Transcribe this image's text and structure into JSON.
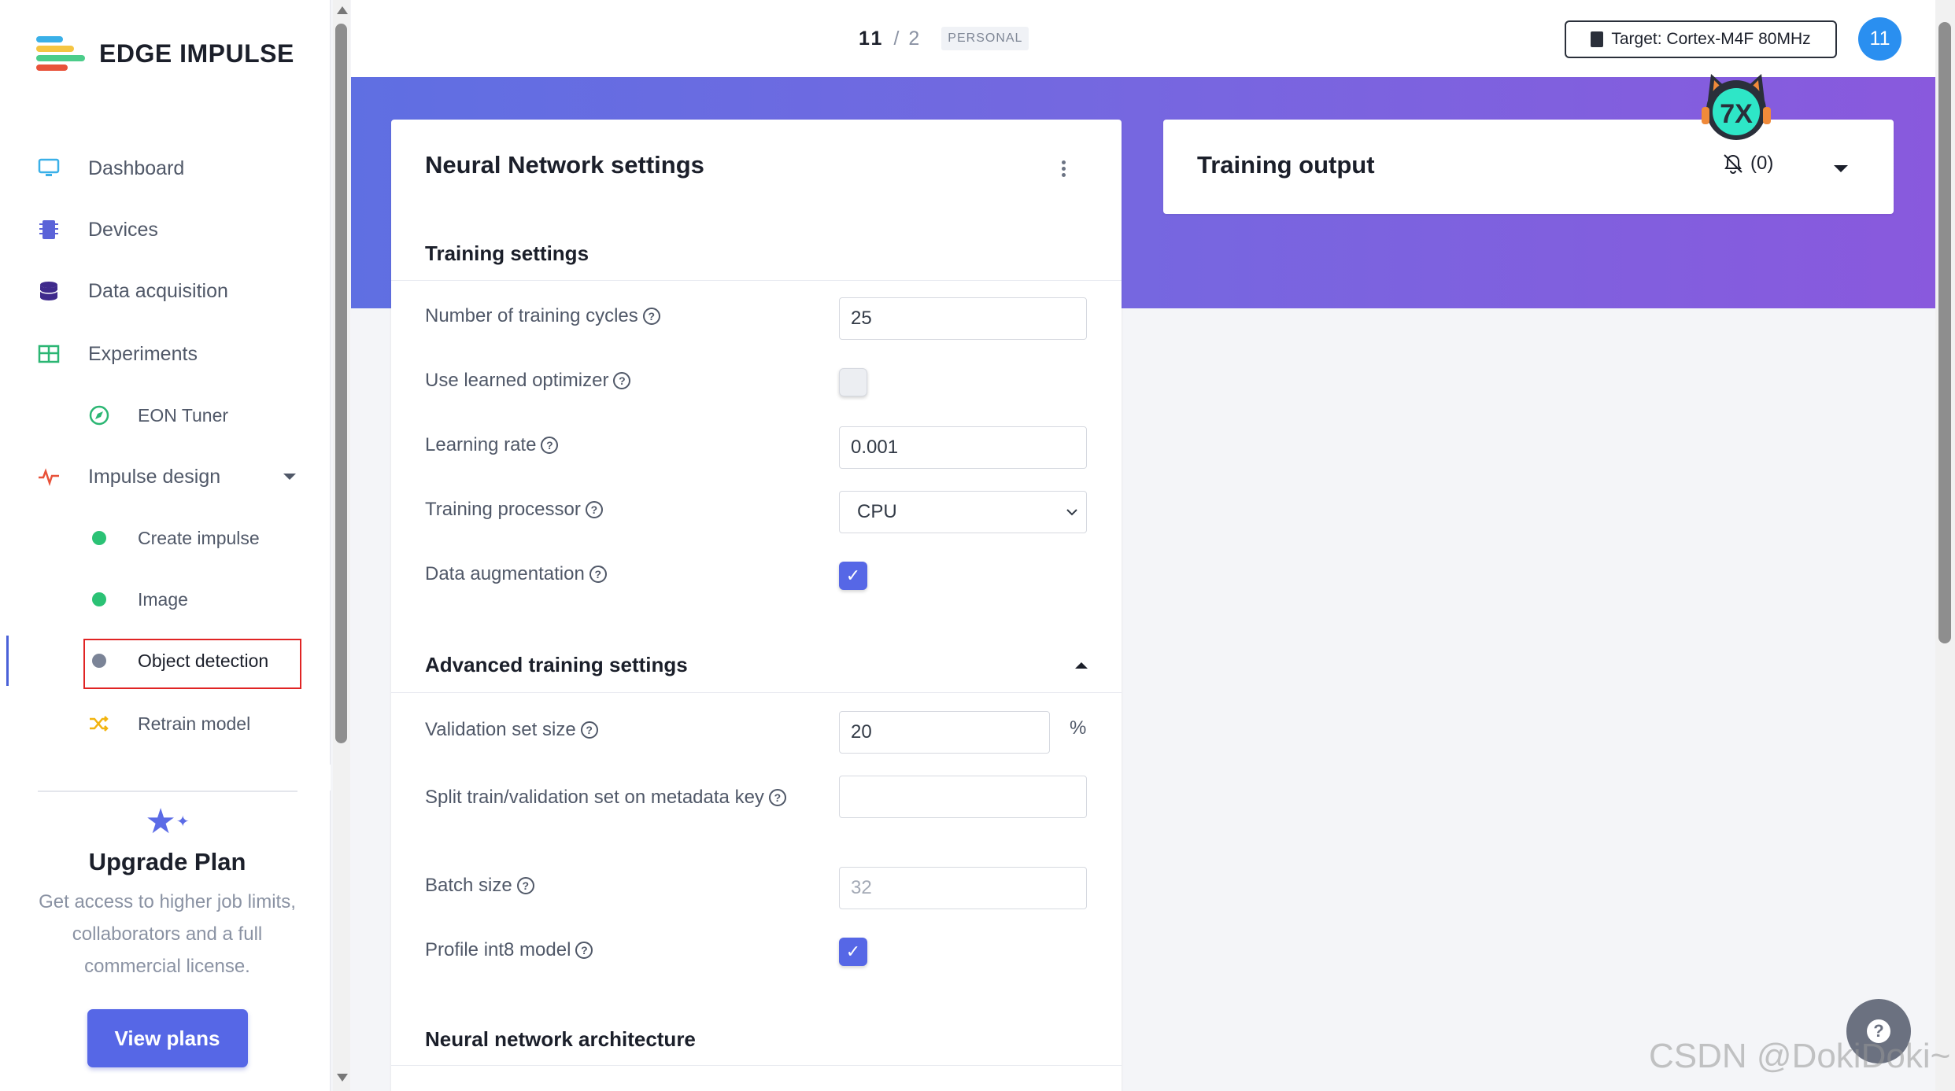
{
  "app": {
    "name": "EDGE IMPULSE"
  },
  "sidebar": {
    "items": [
      {
        "label": "Dashboard"
      },
      {
        "label": "Devices"
      },
      {
        "label": "Data acquisition"
      },
      {
        "label": "Experiments"
      },
      {
        "label": "EON Tuner"
      },
      {
        "label": "Impulse design"
      },
      {
        "label": "Create impulse"
      },
      {
        "label": "Image"
      },
      {
        "label": "Object detection"
      },
      {
        "label": "Retrain model"
      }
    ],
    "upgrade": {
      "title": "Upgrade Plan",
      "text": "Get access to higher job limits, collaborators and a full commercial license.",
      "button": "View plans"
    }
  },
  "header": {
    "project_id": "11",
    "slash": "/",
    "version": "2",
    "badge": "PERSONAL",
    "target": "Target: Cortex-M4F 80MHz",
    "avatar": "11"
  },
  "nn_settings": {
    "title": "Neural Network settings",
    "training_section": "Training settings",
    "fields": {
      "cycles_label": "Number of training cycles",
      "cycles_value": "25",
      "optimizer_label": "Use learned optimizer",
      "lr_label": "Learning rate",
      "lr_value": "0.001",
      "processor_label": "Training processor",
      "processor_value": "CPU",
      "augmentation_label": "Data augmentation"
    },
    "advanced_section": "Advanced training settings",
    "advanced": {
      "val_label": "Validation set size",
      "val_value": "20",
      "val_unit": "%",
      "split_label": "Split train/validation set on metadata key",
      "split_value": "",
      "batch_label": "Batch size",
      "batch_value": "32",
      "int8_label": "Profile int8 model"
    },
    "arch_section": "Neural network architecture"
  },
  "training_output": {
    "title": "Training output",
    "notifications": "(0)"
  },
  "watermark": "CSDN @DokiDoki~",
  "colors": {
    "accent": "#5667e6",
    "banner_start": "#5f6fe2",
    "banner_end": "#8959dd"
  }
}
